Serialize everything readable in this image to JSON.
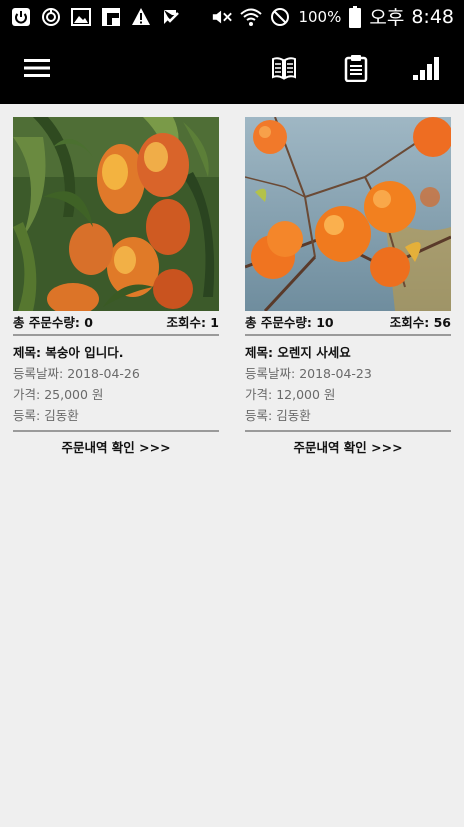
{
  "status_bar": {
    "battery_percent": "100%",
    "ampm": "오후",
    "time": "8:48",
    "icons": [
      "power-icon",
      "sync-icon",
      "gallery-icon",
      "flipboard-icon",
      "warning-icon",
      "check-icon",
      "mute-icon",
      "wifi-icon",
      "blocked-icon",
      "battery-icon"
    ]
  },
  "toolbar": {
    "icons": [
      "menu-icon",
      "book-icon",
      "clipboard-icon",
      "bar-chart-icon"
    ],
    "background": "#000000"
  },
  "products": [
    {
      "image": "peaches",
      "order_qty_label": "총 주문수량: ",
      "order_qty": "0",
      "views_label": "조회수: ",
      "views": "1",
      "title_label": "제목: ",
      "title": "복숭아 입니다.",
      "date_label": "등록날짜: ",
      "date": "2018-04-26",
      "price_label": "가격: ",
      "price": "25,000 원",
      "seller_label": "등록: ",
      "seller": "김동환",
      "link": "주문내역 확인 >>>"
    },
    {
      "image": "oranges",
      "order_qty_label": "총 주문수량: ",
      "order_qty": "10",
      "views_label": "조회수: ",
      "views": "56",
      "title_label": "제목: ",
      "title": "오렌지 사세요",
      "date_label": "등록날짜: ",
      "date": "2018-04-23",
      "price_label": "가격: ",
      "price": "12,000 원",
      "seller_label": "등록: ",
      "seller": "김동환",
      "link": "주문내역 확인 >>>"
    }
  ]
}
